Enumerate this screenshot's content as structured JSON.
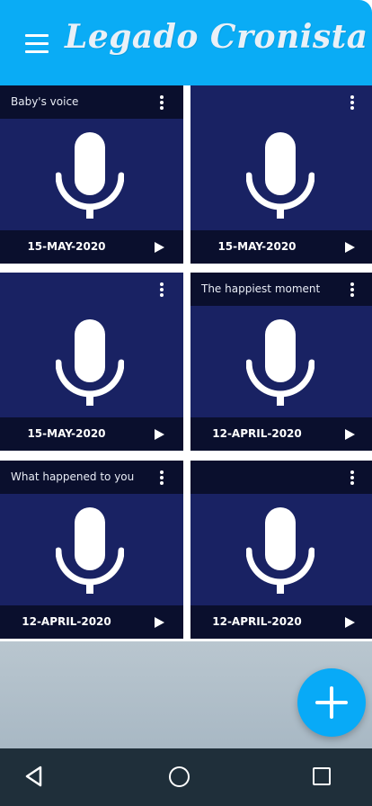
{
  "app_bar": {
    "title": "Legado Cronista",
    "menu_icon": "menu-icon",
    "color": "#0aacf5"
  },
  "recordings": [
    {
      "title": "Baby's voice",
      "date": "15-MAY-2020"
    },
    {
      "title": "",
      "date": "15-MAY-2020"
    },
    {
      "title": "",
      "date": "15-MAY-2020"
    },
    {
      "title": "The happiest moment",
      "date": "12-APRIL-2020"
    },
    {
      "title": "What happened to you",
      "date": "12-APRIL-2020"
    },
    {
      "title": "",
      "date": "12-APRIL-2020"
    }
  ],
  "card_icons": {
    "main": "microphone-icon",
    "options": "more-vert-icon",
    "play": "play-icon"
  },
  "colors": {
    "card_background": "#192263",
    "card_bar": "#0a0f2d",
    "fab": "#08aaf7",
    "nav_bar": "#1f2f3a"
  },
  "fab": {
    "icon": "add-icon"
  },
  "nav_bar": {
    "icons": [
      "back-icon",
      "home-icon",
      "recents-icon"
    ]
  }
}
